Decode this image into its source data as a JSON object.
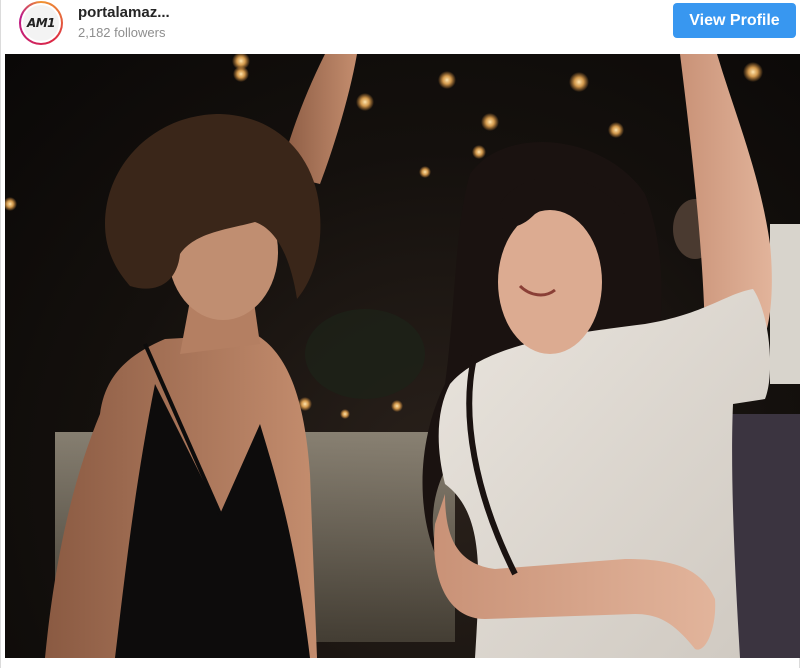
{
  "account": {
    "username": "portalamaz...",
    "followers": "2,182 followers",
    "avatar_logo_text": "AM1"
  },
  "actions": {
    "view_profile_label": "View Profile"
  },
  "icons": [
    "brand-avatar-icon"
  ],
  "colors": {
    "accent": "#3897f0",
    "username": "#262626",
    "secondary_text": "#8e8e8e",
    "photo_background": "#0e0b09"
  }
}
